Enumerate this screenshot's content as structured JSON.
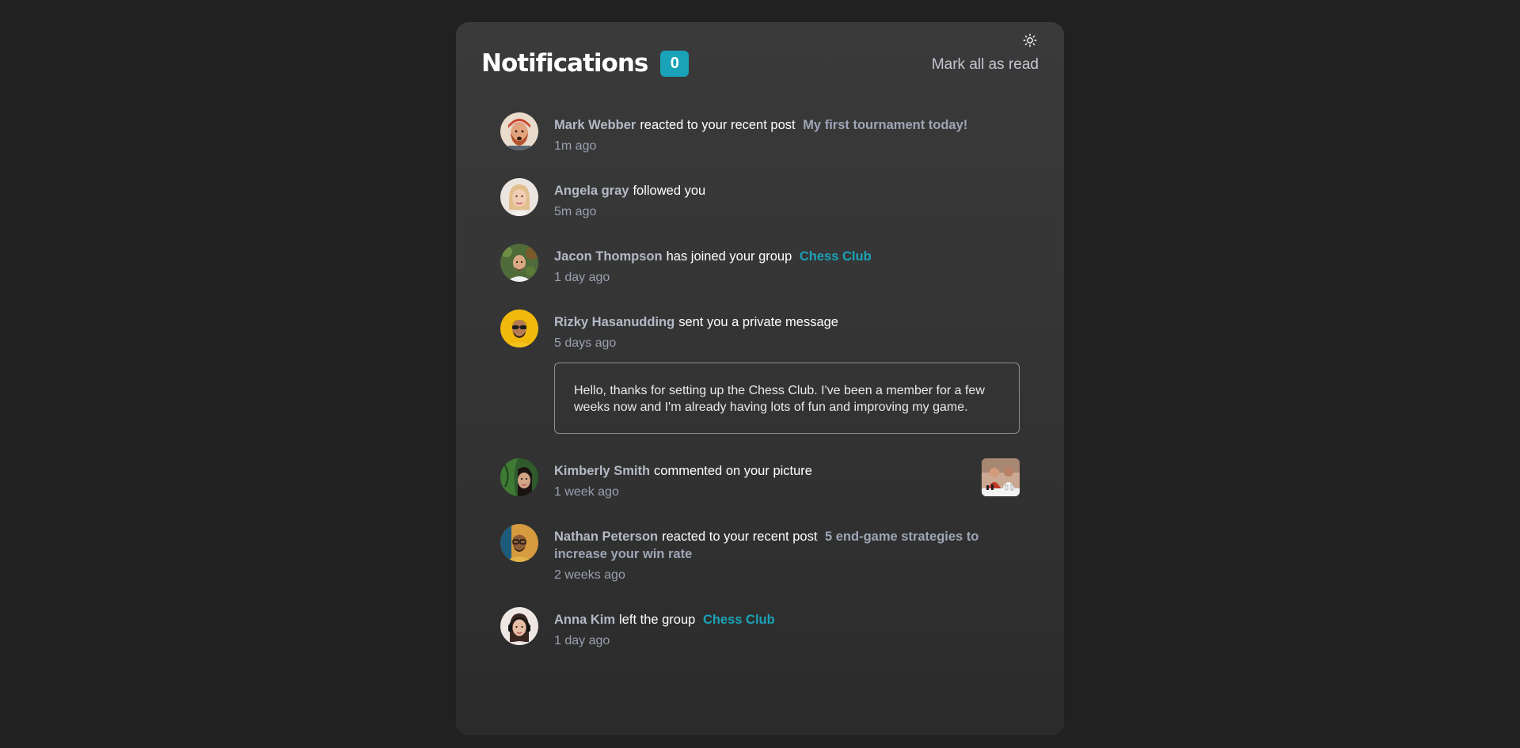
{
  "header": {
    "title": "Notifications",
    "unread_count": "0",
    "mark_all_label": "Mark all as read"
  },
  "theme_toggle_icon": "sun-icon",
  "colors": {
    "accent": "#1aa3b8",
    "background": "#212121",
    "card": "#3a3a3a"
  },
  "notifications": [
    {
      "name": "Mark Webber",
      "action": "reacted to your recent post",
      "post": "My first tournament today!",
      "time": "1m ago"
    },
    {
      "name": "Angela gray",
      "action": "followed you",
      "time": "5m ago"
    },
    {
      "name": "Jacon Thompson",
      "action": "has joined your group",
      "group": "Chess Club",
      "time": "1 day ago"
    },
    {
      "name": "Rizky Hasanudding",
      "action": "sent you a private message",
      "time": "5 days ago",
      "message": "Hello, thanks for setting up the Chess Club. I've been a member for a few weeks now and I'm already having lots of fun and improving my game."
    },
    {
      "name": "Kimberly Smith",
      "action": "commented on your picture",
      "time": "1 week ago"
    },
    {
      "name": "Nathan Peterson",
      "action": "reacted to your recent post",
      "post": "5 end-game strategies to increase your win rate",
      "time": "2 weeks ago"
    },
    {
      "name": "Anna Kim",
      "action": "left the group",
      "group": "Chess Club",
      "time": "1 day ago"
    }
  ]
}
